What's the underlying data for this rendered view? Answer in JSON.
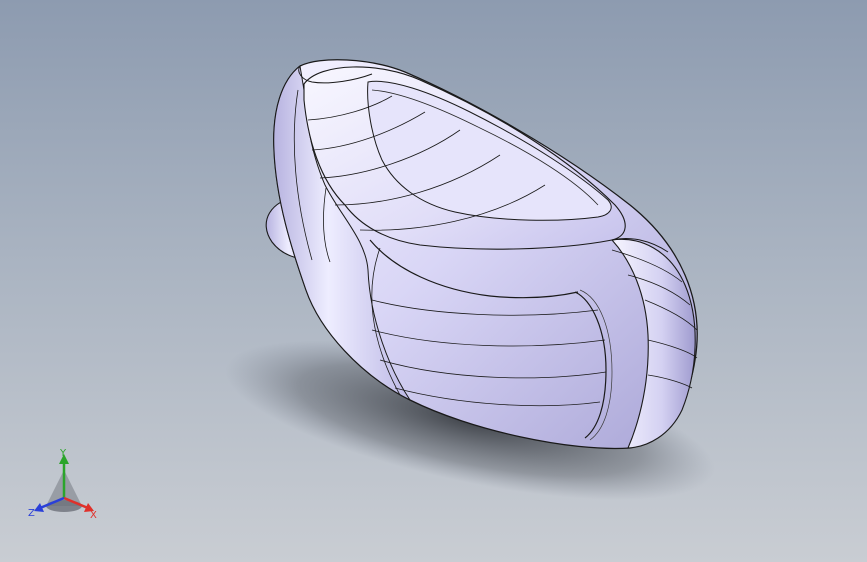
{
  "viewport": {
    "background_top": "#8d9bb0",
    "background_bottom": "#c9cdd3",
    "model_fill": "#d6d4f3",
    "model_edge": "#1a1a1a"
  },
  "triad": {
    "x_label": "X",
    "y_label": "Y",
    "z_label": "Z",
    "x_color": "#e0302a",
    "y_color": "#2ba52b",
    "z_color": "#2a3fd8"
  }
}
